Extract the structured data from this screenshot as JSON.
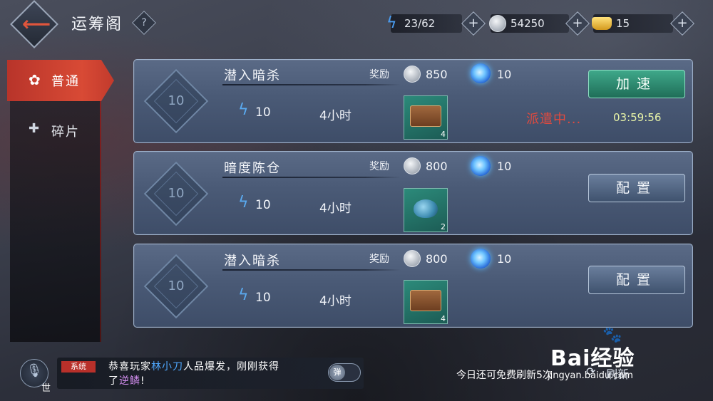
{
  "header": {
    "title": "运筹阁",
    "help_label": "?",
    "energy": "23/62",
    "silver": "54250",
    "gold": "15"
  },
  "sidebar": {
    "tabs": [
      {
        "label": "普通",
        "icon": "flower-icon",
        "active": true
      },
      {
        "label": "碎片",
        "icon": "puzzle-icon",
        "active": false
      }
    ]
  },
  "missions": [
    {
      "level": "10",
      "title": "潜入暗杀",
      "energy": "10",
      "duration": "4小时",
      "reward_label": "奖励",
      "silver": "850",
      "orb": "10",
      "item": "chest",
      "item_count": "4",
      "status": "派遣中...",
      "timer": "03:59:56",
      "button": "加速"
    },
    {
      "level": "10",
      "title": "暗度陈仓",
      "energy": "10",
      "duration": "4小时",
      "reward_label": "奖励",
      "silver": "800",
      "orb": "10",
      "item": "beetle",
      "item_count": "2",
      "button": "配置"
    },
    {
      "level": "10",
      "title": "潜入暗杀",
      "energy": "10",
      "duration": "4小时",
      "reward_label": "奖励",
      "silver": "800",
      "orb": "10",
      "item": "chest",
      "item_count": "4",
      "button": "配置"
    }
  ],
  "chat": {
    "channel": "世",
    "tag": "系统",
    "line1_pre": "恭喜玩家",
    "player": "林小刀",
    "line1_post": "人品爆发，刚刚获得",
    "line2_pre": "了",
    "item": "逆鳞",
    "line2_post": "!",
    "toggle": "弹"
  },
  "footer": {
    "free_refresh": "今日还可免费刷新5次",
    "refresh": "刷新"
  },
  "watermark": {
    "brand": "Bai经验",
    "url": "jingyan.baidu.com"
  }
}
